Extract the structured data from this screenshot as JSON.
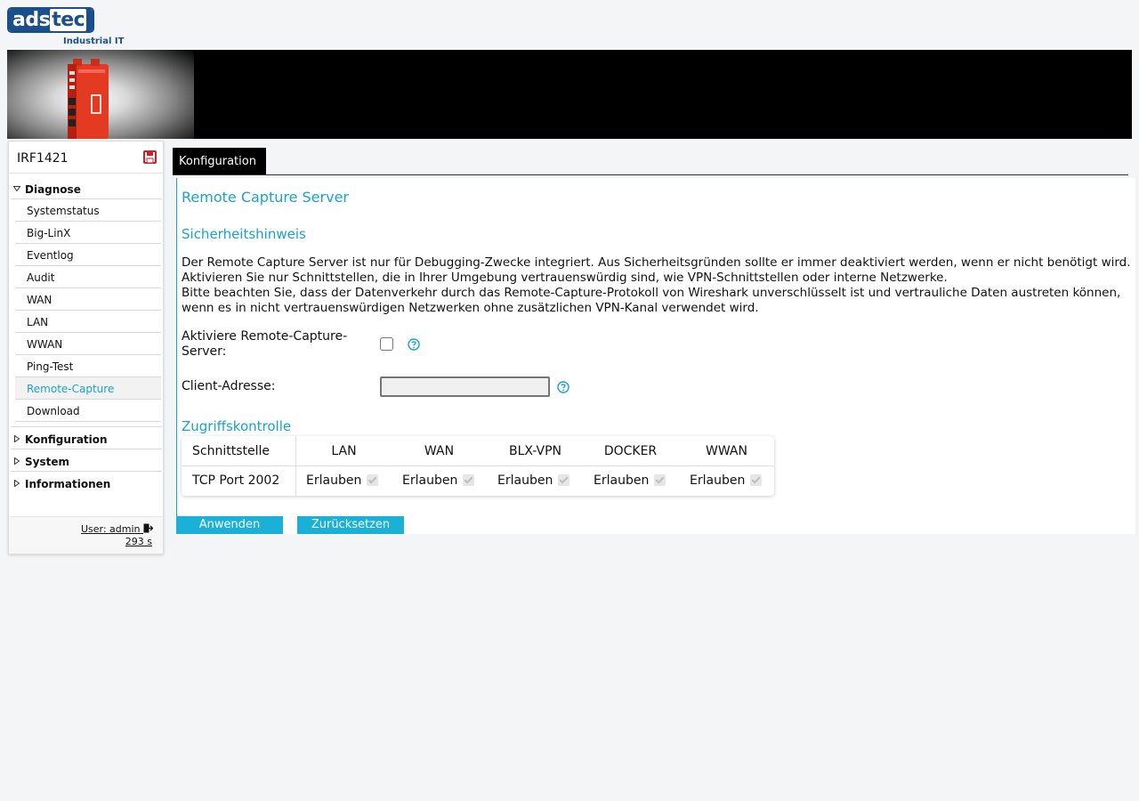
{
  "brand": {
    "logo_text_left": "ads",
    "logo_text_right": "tec",
    "subtitle": "Industrial IT"
  },
  "sidebar": {
    "device_name": "IRF1421",
    "save_icon": "save-icon",
    "groups": [
      {
        "label": "Diagnose",
        "expanded": true,
        "items": [
          {
            "label": "Systemstatus"
          },
          {
            "label": "Big-LinX"
          },
          {
            "label": "Eventlog"
          },
          {
            "label": "Audit"
          },
          {
            "label": "WAN"
          },
          {
            "label": "LAN"
          },
          {
            "label": "WWAN"
          },
          {
            "label": "Ping-Test"
          },
          {
            "label": "Remote-Capture",
            "active": true
          },
          {
            "label": "Download"
          }
        ]
      },
      {
        "label": "Konfiguration",
        "expanded": false
      },
      {
        "label": "System",
        "expanded": false
      },
      {
        "label": "Informationen",
        "expanded": false
      }
    ],
    "user_label": "User: admin",
    "session_timer": "293 s"
  },
  "tabs": [
    {
      "label": "Konfiguration",
      "active": true
    }
  ],
  "main": {
    "title": "Remote Capture Server",
    "security_heading": "Sicherheitshinweis",
    "notice_lines": [
      "Der Remote Capture Server ist nur für Debugging-Zwecke integriert. Aus Sicherheitsgründen sollte er immer deaktiviert werden, wenn er nicht benötigt wird.",
      "Aktivieren Sie nur Schnittstellen, die in Ihrer Umgebung vertrauenswürdig sind, wie VPN-Schnittstellen oder interne Netzwerke.",
      "Bitte beachten Sie, dass der Datenverkehr durch das Remote-Capture-Protokoll von Wireshark unverschlüsselt ist und vertrauliche Daten austreten können,",
      "wenn es in nicht vertrauenswürdigen Netzwerken ohne zusätzlichen VPN-Kanal verwendet wird."
    ],
    "enable_label_line1": "Aktiviere Remote-Capture-",
    "enable_label_line2": "Server:",
    "enable_checked": false,
    "client_label": "Client-Adresse:",
    "client_value": "",
    "access_heading": "Zugriffskontrolle",
    "acl": {
      "header_label": "Schnittstelle",
      "columns": [
        "LAN",
        "WAN",
        "BLX-VPN",
        "DOCKER",
        "WWAN"
      ],
      "rows": [
        {
          "label": "TCP Port 2002",
          "values": [
            "Erlauben",
            "Erlauben",
            "Erlauben",
            "Erlauben",
            "Erlauben"
          ],
          "checked": [
            true,
            true,
            true,
            true,
            true
          ],
          "disabled": true
        }
      ]
    },
    "apply_label": "Anwenden",
    "reset_label": "Zurücksetzen"
  },
  "colors": {
    "accent": "#1aa3c9",
    "button": "#1ab0d8",
    "brand_blue": "#1b4f8c",
    "device_red": "#e53a22"
  }
}
